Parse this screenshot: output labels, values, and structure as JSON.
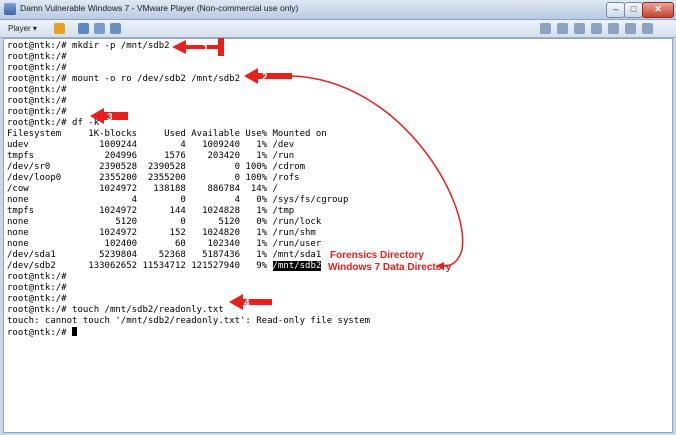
{
  "window": {
    "title": "Damn Vulnerable Windows 7 - VMware Player (Non-commercial use only)",
    "controls": [
      "–",
      "□",
      "✕"
    ]
  },
  "toolbar": {
    "player_label": "Player ▾",
    "icon_names": [
      "pause-icon",
      "send-ctrl-alt-del-icon",
      "fullscreen-icon",
      "unity-icon"
    ],
    "device_icon_names": [
      "printer-icon",
      "network-icon",
      "usb-icon",
      "sound-icon",
      "hdd-icon",
      "cd-icon",
      "display-icon"
    ]
  },
  "terminal": {
    "lines": [
      "root@ntk:/# mkdir -p /mnt/sdb2",
      "root@ntk:/#",
      "root@ntk:/#",
      "root@ntk:/# mount -o ro /dev/sdb2 /mnt/sdb2",
      "root@ntk:/#",
      "root@ntk:/#",
      "root@ntk:/#",
      "root@ntk:/# df -k",
      "Filesystem     1K-blocks     Used Available Use% Mounted on",
      "udev             1009244        4   1009240   1% /dev",
      "tmpfs             204996     1576    203420   1% /run",
      "/dev/sr0         2390528  2390528         0 100% /cdrom",
      "/dev/loop0       2355200  2355200         0 100% /rofs",
      "/cow             1024972   138188    886784  14% /",
      "none                   4        0         4   0% /sys/fs/cgroup",
      "tmpfs            1024972      144   1024828   1% /tmp",
      "none                5120        0      5120   0% /run/lock",
      "none             1024972      152   1024820   1% /run/shm",
      "none              102400       60    102340   1% /run/user",
      "/dev/sda1        5239804    52368   5187436   1% /mnt/sda1",
      "/dev/sdb2      133062652 11534712 121527940   9% ",
      "root@ntk:/#",
      "root@ntk:/#",
      "root@ntk:/#",
      "root@ntk:/# touch /mnt/sdb2/readonly.txt",
      "touch: cannot touch '/mnt/sdb2/readonly.txt': Read-only file system",
      "root@ntk:/# "
    ],
    "highlighted_mount": "/mnt/sdb2"
  },
  "annotations": {
    "step1": "1",
    "step2": "2",
    "step3": "3",
    "step4": "4",
    "label_forensics": "Forensics Directory",
    "label_windows7": "Windows 7 Data Directory",
    "color": "#e8201c"
  }
}
